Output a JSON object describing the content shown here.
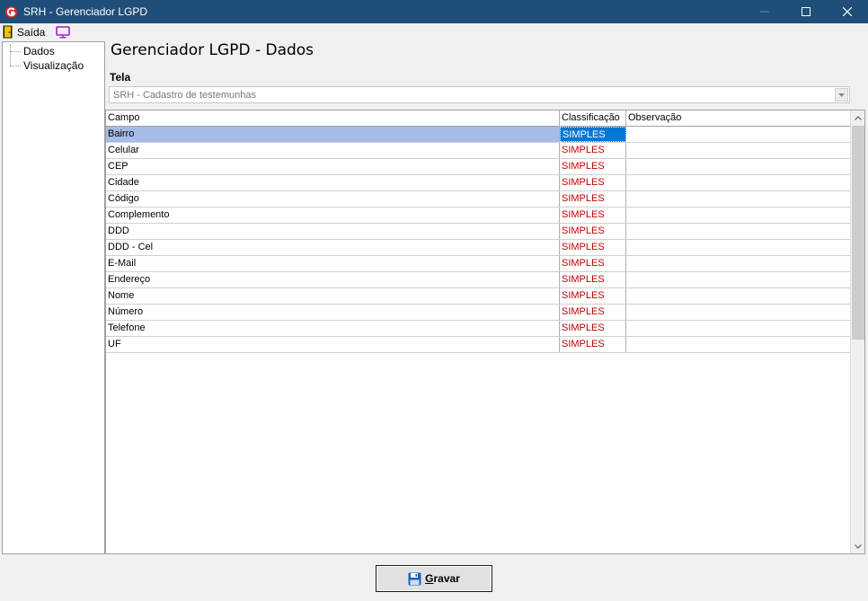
{
  "window": {
    "title": "SRH - Gerenciador LGPD"
  },
  "menu": {
    "exit_label": "Saída"
  },
  "tree": {
    "items": [
      {
        "label": "Dados"
      },
      {
        "label": "Visualização"
      }
    ]
  },
  "main": {
    "title": "Gerenciador LGPD - Dados",
    "screen_label": "Tela",
    "screen_value": "SRH - Cadastro de testemunhas"
  },
  "grid": {
    "columns": [
      "Campo",
      "Classificação",
      "Observação"
    ],
    "rows": [
      {
        "campo": "Bairro",
        "classificacao": "SIMPLES",
        "observacao": ""
      },
      {
        "campo": "Celular",
        "classificacao": "SIMPLES",
        "observacao": ""
      },
      {
        "campo": "CEP",
        "classificacao": "SIMPLES",
        "observacao": ""
      },
      {
        "campo": "Cidade",
        "classificacao": "SIMPLES",
        "observacao": ""
      },
      {
        "campo": "Código",
        "classificacao": "SIMPLES",
        "observacao": ""
      },
      {
        "campo": "Complemento",
        "classificacao": "SIMPLES",
        "observacao": ""
      },
      {
        "campo": "DDD",
        "classificacao": "SIMPLES",
        "observacao": ""
      },
      {
        "campo": "DDD - Cel",
        "classificacao": "SIMPLES",
        "observacao": ""
      },
      {
        "campo": "E-Mail",
        "classificacao": "SIMPLES",
        "observacao": ""
      },
      {
        "campo": "Endereço",
        "classificacao": "SIMPLES",
        "observacao": ""
      },
      {
        "campo": "Nome",
        "classificacao": "SIMPLES",
        "observacao": ""
      },
      {
        "campo": "Número",
        "classificacao": "SIMPLES",
        "observacao": ""
      },
      {
        "campo": "Telefone",
        "classificacao": "SIMPLES",
        "observacao": ""
      },
      {
        "campo": "UF",
        "classificacao": "SIMPLES",
        "observacao": ""
      }
    ],
    "selected_row": 0
  },
  "footer": {
    "save_label_first": "G",
    "save_label_rest": "ravar"
  },
  "icons": {
    "app": "app-logo-icon",
    "exit": "door-exit-icon",
    "monitor": "monitor-icon",
    "save": "floppy-disk-icon"
  },
  "colors": {
    "titlebar": "#1f4e79",
    "classification_text": "#c00000",
    "selection": "#0078d7",
    "row_highlight": "#a6bce8"
  }
}
